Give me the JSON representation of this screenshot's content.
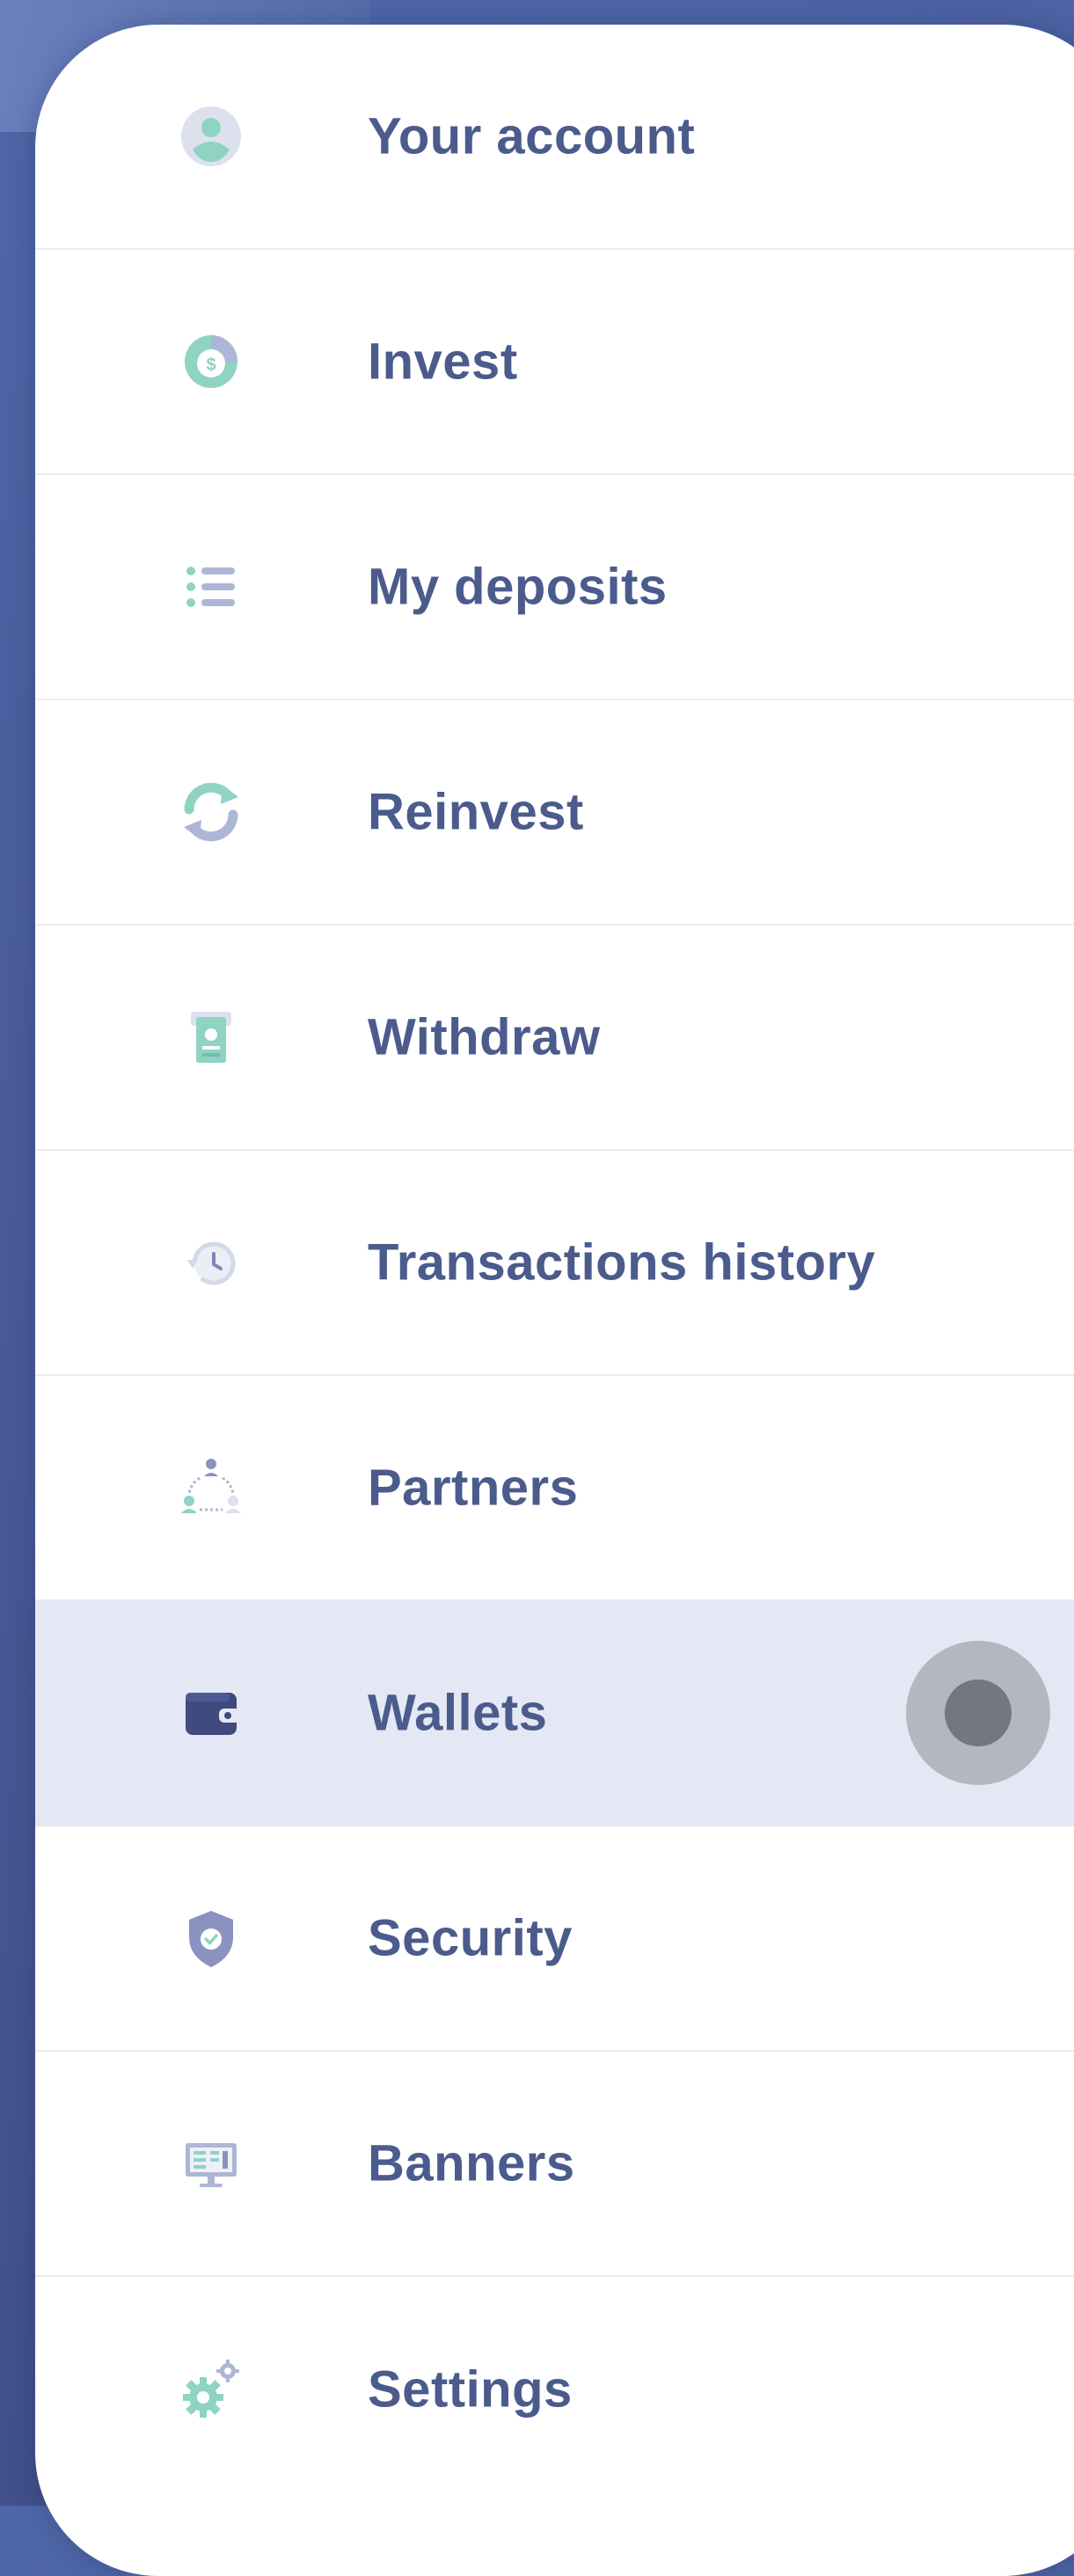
{
  "menu": {
    "items": [
      {
        "label": "Your account",
        "icon": "user-icon"
      },
      {
        "label": "Invest",
        "icon": "dollar-coin-icon"
      },
      {
        "label": "My deposits",
        "icon": "list-icon"
      },
      {
        "label": "Reinvest",
        "icon": "refresh-icon"
      },
      {
        "label": "Withdraw",
        "icon": "withdraw-icon"
      },
      {
        "label": "Transactions history",
        "icon": "history-icon"
      },
      {
        "label": "Partners",
        "icon": "partners-icon"
      },
      {
        "label": "Wallets",
        "icon": "wallet-icon",
        "active": true
      },
      {
        "label": "Security",
        "icon": "shield-icon"
      },
      {
        "label": "Banners",
        "icon": "monitor-icon"
      },
      {
        "label": "Settings",
        "icon": "gears-icon"
      }
    ]
  },
  "colors": {
    "label": "#4b5b8c",
    "accent_teal": "#8fd3c3",
    "accent_lavender": "#aeb6d6",
    "active_bg": "#e4e8f4"
  }
}
